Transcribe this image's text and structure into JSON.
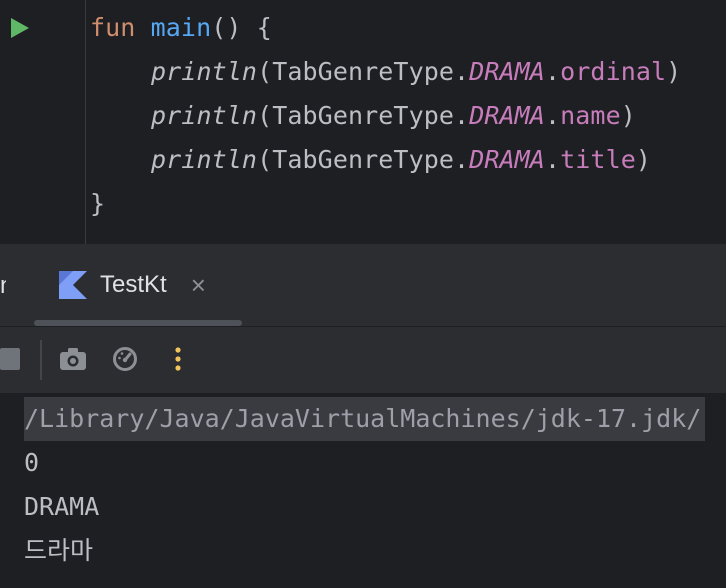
{
  "editor": {
    "line1": {
      "kw": "fun",
      "name": "main",
      "rest": "() {"
    },
    "line2": {
      "call": "println",
      "open": "(TabGenreType.",
      "constant": "DRAMA",
      "dot": ".",
      "property": "ordinal",
      "close": ")"
    },
    "line3": {
      "call": "println",
      "open": "(TabGenreType.",
      "constant": "DRAMA",
      "dot": ".",
      "property": "name",
      "close": ")"
    },
    "line4": {
      "call": "println",
      "open": "(TabGenreType.",
      "constant": "DRAMA",
      "dot": ".",
      "property": "title",
      "close": ")"
    },
    "line5": {
      "text": "}"
    }
  },
  "tabs": {
    "partial_label": "n",
    "active_label": "TestKt",
    "close_glyph": "×"
  },
  "toolbar": {
    "icons": [
      "stop-icon",
      "camera-icon",
      "gauge-icon",
      "more-vertical-icon"
    ]
  },
  "console": {
    "lines": [
      "/Library/Java/JavaVirtualMachines/jdk-17.jdk/",
      "0",
      "DRAMA",
      "드라마"
    ]
  },
  "colors": {
    "background": "#1e1f22",
    "panel": "#2b2d30",
    "keyword": "#cf8e6d",
    "function_declaration": "#56a8f5",
    "enum_property": "#c77dbb",
    "run_green": "#5fb865",
    "more_yellow": "#f2c55c",
    "kotlin_blue": "#7f9ef5"
  }
}
